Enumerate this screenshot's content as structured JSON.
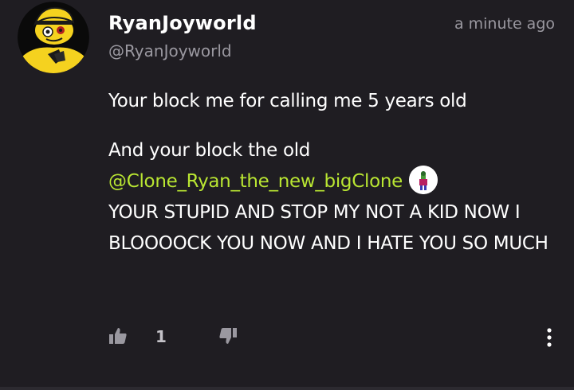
{
  "comment": {
    "username": "RyanJoyworld",
    "handle": "@RyanJoyworld",
    "timestamp": "a minute ago",
    "line1": "Your block me for calling me 5 years old",
    "line2_start": "And your block the old",
    "mention": "@Clone_Ryan_the_new_bigClone",
    "line3": "YOUR STUPID AND STOP MY NOT A KID NOW I BLOOOOCK YOU NOW AND I HATE YOU SO MUCH",
    "like_count": "1"
  },
  "icons": {
    "like": "thumbs-up-icon",
    "dislike": "thumbs-down-icon",
    "more": "more-vertical-icon"
  },
  "colors": {
    "background": "#1f1d22",
    "mention": "#b9e632",
    "secondary_text": "#9a98a0",
    "avatar_bg": "#f5d21f"
  }
}
